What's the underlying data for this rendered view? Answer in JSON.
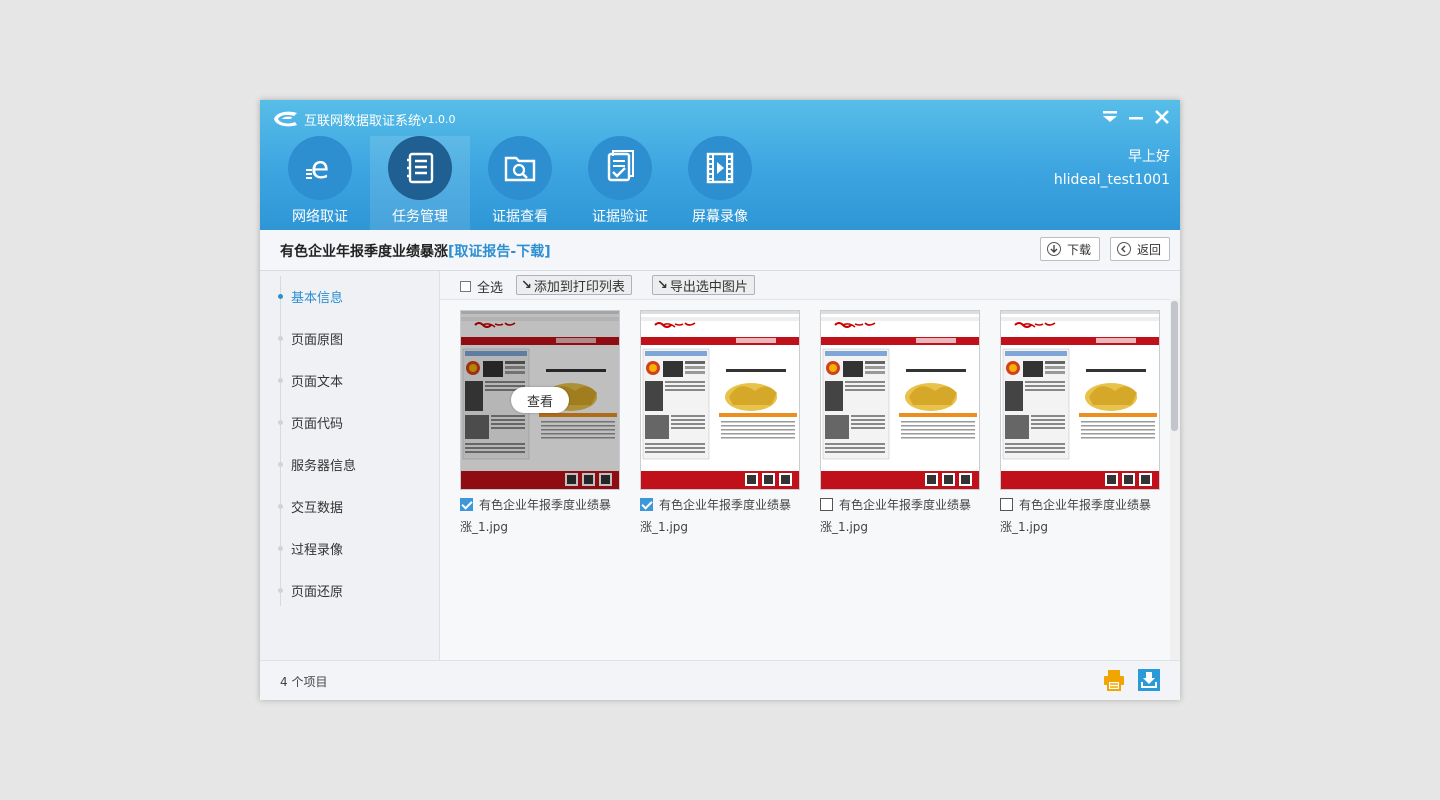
{
  "app": {
    "title": "互联网数据取证系统",
    "version": "v1.0.0",
    "greeting": "早上好",
    "username": "hlideal_test1001"
  },
  "window_controls": [
    "menu-icon",
    "minimize-icon",
    "close-icon"
  ],
  "nav": [
    {
      "label": "网络取证",
      "icon": "web-capture-icon",
      "active": false
    },
    {
      "label": "任务管理",
      "icon": "task-list-icon",
      "active": true
    },
    {
      "label": "证据查看",
      "icon": "folder-search-icon",
      "active": false
    },
    {
      "label": "证据验证",
      "icon": "document-check-icon",
      "active": false
    },
    {
      "label": "屏幕录像",
      "icon": "film-play-icon",
      "active": false
    }
  ],
  "page": {
    "title": "有色企业年报季度业绩暴涨",
    "title_link": "[取证报告-下载]",
    "download_label": "下载",
    "back_label": "返回"
  },
  "sidebar": [
    {
      "label": "基本信息",
      "active": true
    },
    {
      "label": "页面原图",
      "active": false
    },
    {
      "label": "页面文本",
      "active": false
    },
    {
      "label": "页面代码",
      "active": false
    },
    {
      "label": "服务器信息",
      "active": false
    },
    {
      "label": "交互数据",
      "active": false
    },
    {
      "label": "过程录像",
      "active": false
    },
    {
      "label": "页面还原",
      "active": false
    }
  ],
  "toolbar": {
    "select_all": "全选",
    "add_print": "添加到打印列表",
    "export_images": "导出选中图片"
  },
  "images": [
    {
      "name_line1": "有色企业年报季度业绩暴",
      "name_line2": "涨_1.jpg",
      "checked": true,
      "hover": true,
      "view_label": "查看"
    },
    {
      "name_line1": "有色企业年报季度业绩暴",
      "name_line2": "涨_1.jpg",
      "checked": true,
      "hover": false
    },
    {
      "name_line1": "有色企业年报季度业绩暴",
      "name_line2": "涨_1.jpg",
      "checked": false,
      "hover": false
    },
    {
      "name_line1": "有色企业年报季度业绩暴",
      "name_line2": "涨_1.jpg",
      "checked": false,
      "hover": false
    }
  ],
  "footer": {
    "count": "4 个项目",
    "icons": [
      "print-icon",
      "download-icon"
    ]
  },
  "colors": {
    "header": "#3ca5e0",
    "accent": "#2d8fd2",
    "print_icon": "#f0a500",
    "download_icon": "#2b9ad8"
  }
}
